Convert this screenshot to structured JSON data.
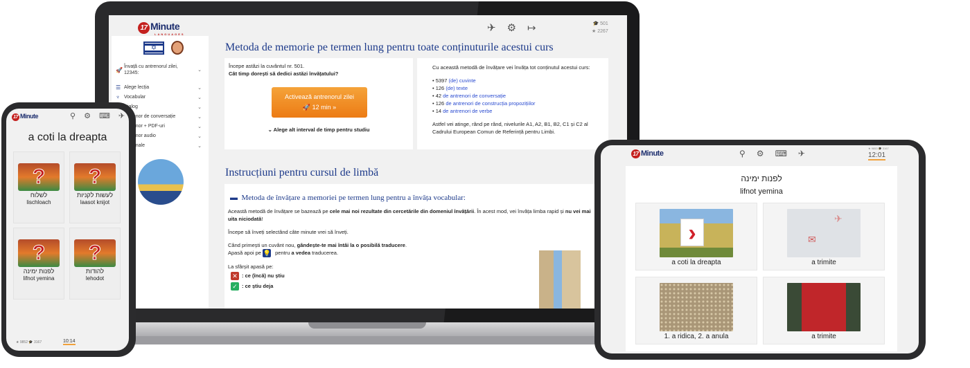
{
  "brand": {
    "logo_num": "17",
    "logo_word": "Minute",
    "logo_sub": "LANGUAGES"
  },
  "laptop": {
    "stats": {
      "top": "501",
      "bottom": "2267"
    },
    "flag_symbol": "✡",
    "sidebar": [
      {
        "icon": "rocket-icon",
        "label": "Învață cu antrenorul zilei, 12345:"
      },
      {
        "icon": "list-icon",
        "label": "Alege lecția"
      },
      {
        "icon": "vocab-icon",
        "label": "Vocabular"
      },
      {
        "icon": "dialog-icon",
        "label": "Dialog"
      },
      {
        "icon": "trainer-icon",
        "label": "Antrenor de conversație"
      },
      {
        "icon": "pdf-icon",
        "label": "Antrenor + PDF-uri"
      },
      {
        "icon": "audio-icon",
        "label": "Antrenor audio"
      },
      {
        "icon": "more-icon",
        "label": "Opționale"
      }
    ],
    "main_title": "Metoda de memorie pe termen lung pentru toate conținuturile acestui curs",
    "card1": {
      "line1": "Începe astăzi la cuvântul nr. 501.",
      "line2": "Cât timp dorești să dedici astăzi învățatului?",
      "btn_line1": "Activează antrenorul zilei",
      "btn_line2": "🚀 12 min »",
      "alt_link": "⌄ Alege alt interval de timp pentru studiu"
    },
    "card2": {
      "intro": "Cu această metodă de învățare vei învăța tot conținutul acestui curs:",
      "items": [
        {
          "count": "• 5397 ",
          "link": "(de) cuvinte"
        },
        {
          "count": "• 126 ",
          "link": "(de) texte"
        },
        {
          "count": "• 42 ",
          "link": "de antrenori de conversație"
        },
        {
          "count": "• 126 ",
          "link": "de antrenori de construcția propozițiilor"
        },
        {
          "count": "• 14 ",
          "link": "de antrenori de verbe"
        }
      ],
      "outro": "Astfel vei atinge, rând pe rând, nivelurile A1, A2, B1, B2, C1 și C2 al Cadrului European Comun de Referință pentru Limbi."
    },
    "title2": "Instrucțiuni pentru cursul de limbă",
    "card3": {
      "sub_title": "Metoda de învățare a memoriei pe termen lung pentru a învăța vocabular:",
      "p1a": "Această metodă de învățare se bazează pe ",
      "p1b": "cele mai noi rezultate din cercetările din domeniul învățării",
      "p1c": ". În acest mod, vei învăța limba rapid și ",
      "p1d": "nu vei mai uita niciodată",
      "p1e": "!",
      "p2": "Începe să înveți selectând câte minute vrei să înveți.",
      "p3a": "Când primești un cuvânt nou, ",
      "p3b": "gândește-te mai întâi la o posibilă traducere",
      "p3c": ".",
      "p4a": "Apasă apoi pe ",
      "p4b": " pentru ",
      "p4c": "a vedea",
      "p4d": " traducerea.",
      "p5": "La sfârșit apasă pe:",
      "opt1": ": ce (încă) nu știu",
      "opt2": ": ce știu deja"
    }
  },
  "phone": {
    "word": "a coti la dreapta",
    "tiles": [
      {
        "heb": "לשלוח",
        "lat": "lischloach"
      },
      {
        "heb": "לעשות לקניות",
        "lat": "laasot knijot"
      },
      {
        "heb": "לפנות ימינה",
        "lat": "lifnot yemina"
      },
      {
        "heb": "להודות",
        "lat": "lehodot"
      }
    ],
    "stats": "★ 9852 🎓 3167",
    "time": "10:14"
  },
  "tablet": {
    "stats": "★ 9853 🎓 3167",
    "time": "12:01",
    "heb": "לפנות ימינה",
    "lat": "lifnot yemina",
    "tiles": [
      {
        "label": "a coti la dreapta",
        "color": "#c8b35a"
      },
      {
        "label": "a trimite",
        "color": "#c9cdd2"
      },
      {
        "label": "1. a ridica, 2. a anula",
        "color": "#b9a98c"
      },
      {
        "label": "a trimite",
        "color": "#b52b2b"
      }
    ]
  }
}
